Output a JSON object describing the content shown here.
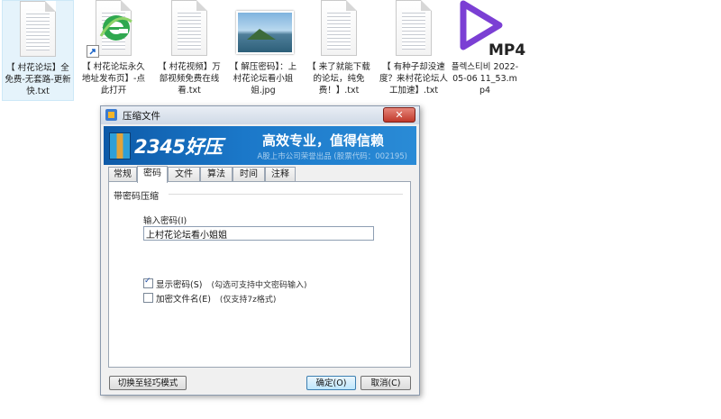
{
  "desktop": {
    "files": [
      {
        "name": "【 村花论坛】全免费-无套路-更新快.txt",
        "selected": true
      },
      {
        "name": "【 村花论坛永久地址发布页】-点此打开"
      },
      {
        "name": "【 村花视频】万部视频免费在线看.txt"
      },
      {
        "name": "【 解压密码】：上村花论坛看小姐姐.jpg"
      },
      {
        "name": "【 来了就能下载的论坛，纯免费！】.txt"
      },
      {
        "name": "【 有种子却没速度？来村花论坛人工加速】.txt"
      },
      {
        "name": "플렉스티비 2022-05-06 11_53.mp4",
        "badge": "MP4"
      }
    ]
  },
  "dialog": {
    "title": "压缩文件",
    "close_label": "✕",
    "banner": {
      "brand": "2345好压",
      "slogan": "高效专业，值得信赖",
      "sub": "A股上市公司荣誉出品 (股票代码：002195)"
    },
    "tabs": [
      "常规",
      "密码",
      "文件",
      "算法",
      "时间",
      "注释"
    ],
    "active_tab": "密码",
    "group_title": "带密码压缩",
    "password_label": "输入密码(I)",
    "password_value": "上村花论坛看小姐姐",
    "show_password": {
      "label": "显示密码(S)",
      "hint": "(勾选可支持中文密码输入)",
      "checked": true
    },
    "encrypt_names": {
      "label": "加密文件名(E)",
      "hint": "(仅支持7z格式)",
      "checked": false
    },
    "buttons": {
      "switch_mode": "切换至轻巧模式",
      "ok": "确定(O)",
      "cancel": "取消(C)"
    }
  },
  "colors": {
    "banner": "#1b78c9",
    "mp4_accent": "#7b3fd4",
    "ie_green": "#2fa84f"
  }
}
